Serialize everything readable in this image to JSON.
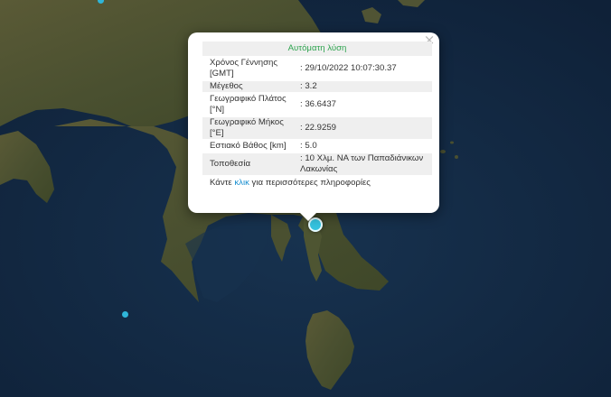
{
  "popup": {
    "title": "Αυτόματη λύση",
    "close_symbol": "×",
    "rows": [
      {
        "key": "Χρόνος Γέννησης [GMT]",
        "value": ": 29/10/2022 10:07:30.37"
      },
      {
        "key": "Μέγεθος",
        "value": ": 3.2"
      },
      {
        "key": "Γεωγραφικό Πλάτος [°N]",
        "value": ": 36.6437"
      },
      {
        "key": "Γεωγραφικό Μήκος [°E]",
        "value": ": 22.9259"
      },
      {
        "key": "Εστιακό Βάθος [km]",
        "value": ": 5.0"
      },
      {
        "key": "Τοποθεσία",
        "value": ": 10 Χλμ. ΝΑ των Παπαδιάνικων Λακωνίας"
      }
    ],
    "footer": {
      "before": "Κάντε ",
      "link": "κλικ",
      "after": " για περισσότερες πληροφορίες"
    }
  },
  "map": {
    "sea_color": "#142a45",
    "land_color": "#4a5030",
    "marker_color": "#35c4e0"
  }
}
